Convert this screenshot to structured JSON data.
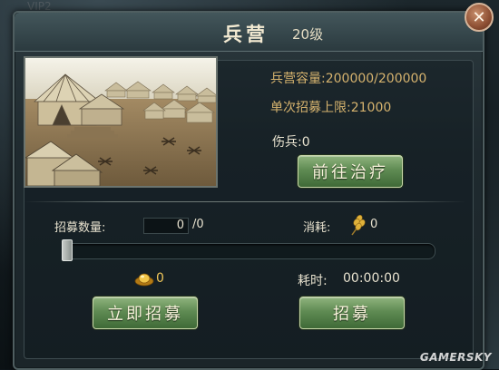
{
  "header": {
    "vip_ghost": "VIP2",
    "title": "兵营",
    "level": "20级"
  },
  "info": {
    "capacity": "兵营容量:200000/200000",
    "recruit_limit": "单次招募上限:21000",
    "wounded": "伤兵:0",
    "heal_button": "前往治疗"
  },
  "recruit": {
    "quantity_label": "招募数量:",
    "quantity_value": "0",
    "quantity_max": "/0",
    "consume_label": "消耗:",
    "consume_value": "0",
    "slider_fraction": 0,
    "gold_cost": "0",
    "time_label": "耗时:",
    "time_value": "00:00:00",
    "instant_button": "立即招募",
    "recruit_button": "招募"
  },
  "icons": {
    "close": "close-icon",
    "gold": "gold-ingot-icon",
    "wheat": "wheat-icon"
  },
  "watermark": "GAMERSKY",
  "colors": {
    "accent_gold": "#d6b36e",
    "button_green": "#5f8b53"
  }
}
